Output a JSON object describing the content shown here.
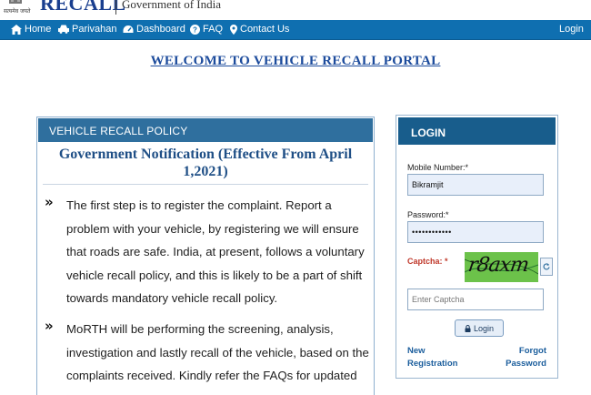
{
  "header": {
    "emblem_caption": "सत्यमेव जयते",
    "brand": "RECALL",
    "government": "Government of India"
  },
  "nav": {
    "home": "Home",
    "parivahan": "Parivahan",
    "dashboard": "Dashboard",
    "faq": "FAQ",
    "contact": "Contact Us",
    "login": "Login"
  },
  "welcome": "WELCOME TO VEHICLE RECALL PORTAL",
  "policy": {
    "header": "VEHICLE RECALL POLICY",
    "title": "Government Notification (Effective From April 1,2021)",
    "bullet_mark": "»",
    "bullets": [
      "The first step is to register the complaint. Report a problem with your vehicle, by registering we will ensure that roads are safe. India, at present, follows a voluntary vehicle recall policy, and this is likely to be a part of shift towards mandatory vehicle recall policy.",
      "MoRTH will be performing the screening, analysis, investigation and lastly recall of the vehicle, based on the complaints received. Kindly refer the FAQs for updated"
    ]
  },
  "login": {
    "header": "LOGIN",
    "mobile_label": "Mobile Number:*",
    "mobile_value": "Bikramjit",
    "password_label": "Password:*",
    "password_value": "••••••••••••",
    "captcha_label": "Captcha: *",
    "captcha_image_text": "r8axm",
    "captcha_placeholder": "Enter Captcha",
    "login_button": "Login",
    "new_registration_line1": "New",
    "new_registration_line2": "Registration",
    "forgot_password_line1": "Forgot",
    "forgot_password_line2": "Password"
  },
  "colors": {
    "navbar": "#0f6fb0",
    "panel_header": "#2f6f9e",
    "login_header": "#185d8c",
    "accent_text": "#1c4b9c",
    "captcha_required": "#c0392b",
    "captcha_bg": "#6cc24a"
  },
  "icons": {
    "home": "home-icon",
    "parivahan": "car-icon",
    "dashboard": "dashboard-icon",
    "faq": "question-icon",
    "contact": "map-marker-icon",
    "refresh": "refresh-icon",
    "lock": "lock-icon",
    "emblem": "emblem-icon"
  }
}
